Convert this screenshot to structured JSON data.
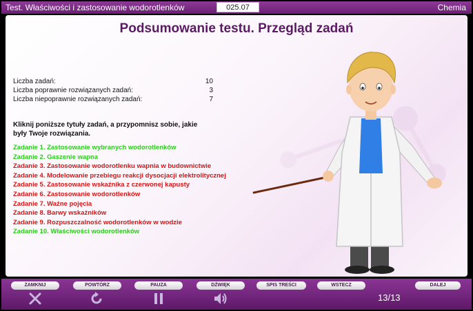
{
  "header": {
    "title": "Test. Właściwości i zastosowanie wodorotlenków",
    "code": "025.07",
    "subject": "Chemia"
  },
  "main": {
    "title": "Podsumowanie testu. Przegląd zadań",
    "stats": [
      {
        "label": "Liczba zadań:",
        "value": "10"
      },
      {
        "label": "Liczba poprawnie rozwiązanych zadań:",
        "value": "3"
      },
      {
        "label": "Liczba niepoprawnie rozwiązanych zadań:",
        "value": "7"
      }
    ],
    "instruction": "Kliknij poniższe tytuły zadań, a przypomnisz sobie, jakie były Twoje rozwiązania.",
    "tasks": [
      {
        "label": "Zadanie 1. Zastosowanie wybranych wodorotlenków",
        "status": "correct"
      },
      {
        "label": "Zadanie 2. Gaszenie wapna",
        "status": "correct"
      },
      {
        "label": "Zadanie 3. Zastosowanie wodorotlenku wapnia w budownictwie",
        "status": "incorrect"
      },
      {
        "label": "Zadanie 4. Modelowanie przebiegu reakcji dysocjacji elektrolitycznej",
        "status": "incorrect"
      },
      {
        "label": "Zadanie 5. Zastosowanie wskaźnika z czerwonej kapusty",
        "status": "incorrect"
      },
      {
        "label": "Zadanie 6. Zastosowanie wodorotlenków",
        "status": "incorrect"
      },
      {
        "label": "Zadanie 7. Ważne pojęcia",
        "status": "incorrect"
      },
      {
        "label": "Zadanie 8. Barwy wskaźników",
        "status": "incorrect"
      },
      {
        "label": "Zadanie 9. Rozpuszczalność wodorotlenków w wodzie",
        "status": "incorrect"
      },
      {
        "label": "Zadanie 10. Właściwości wodorotlenków",
        "status": "correct"
      }
    ]
  },
  "footer": {
    "buttons": {
      "close": "ZAMKNIJ",
      "repeat": "POWTÓRZ",
      "pause": "PAUZA",
      "sound": "DŹWIĘK",
      "contents": "SPIS TREŚCI",
      "back": "WSTECZ",
      "next": "DALEJ"
    },
    "icons": {
      "close": "close-icon",
      "repeat": "repeat-icon",
      "pause": "pause-icon",
      "sound": "speaker-icon"
    },
    "page": "13/13"
  },
  "colors": {
    "brand": "#6a1f73",
    "title": "#5b1a63",
    "correct": "#2dcc1e",
    "incorrect": "#d81414"
  }
}
